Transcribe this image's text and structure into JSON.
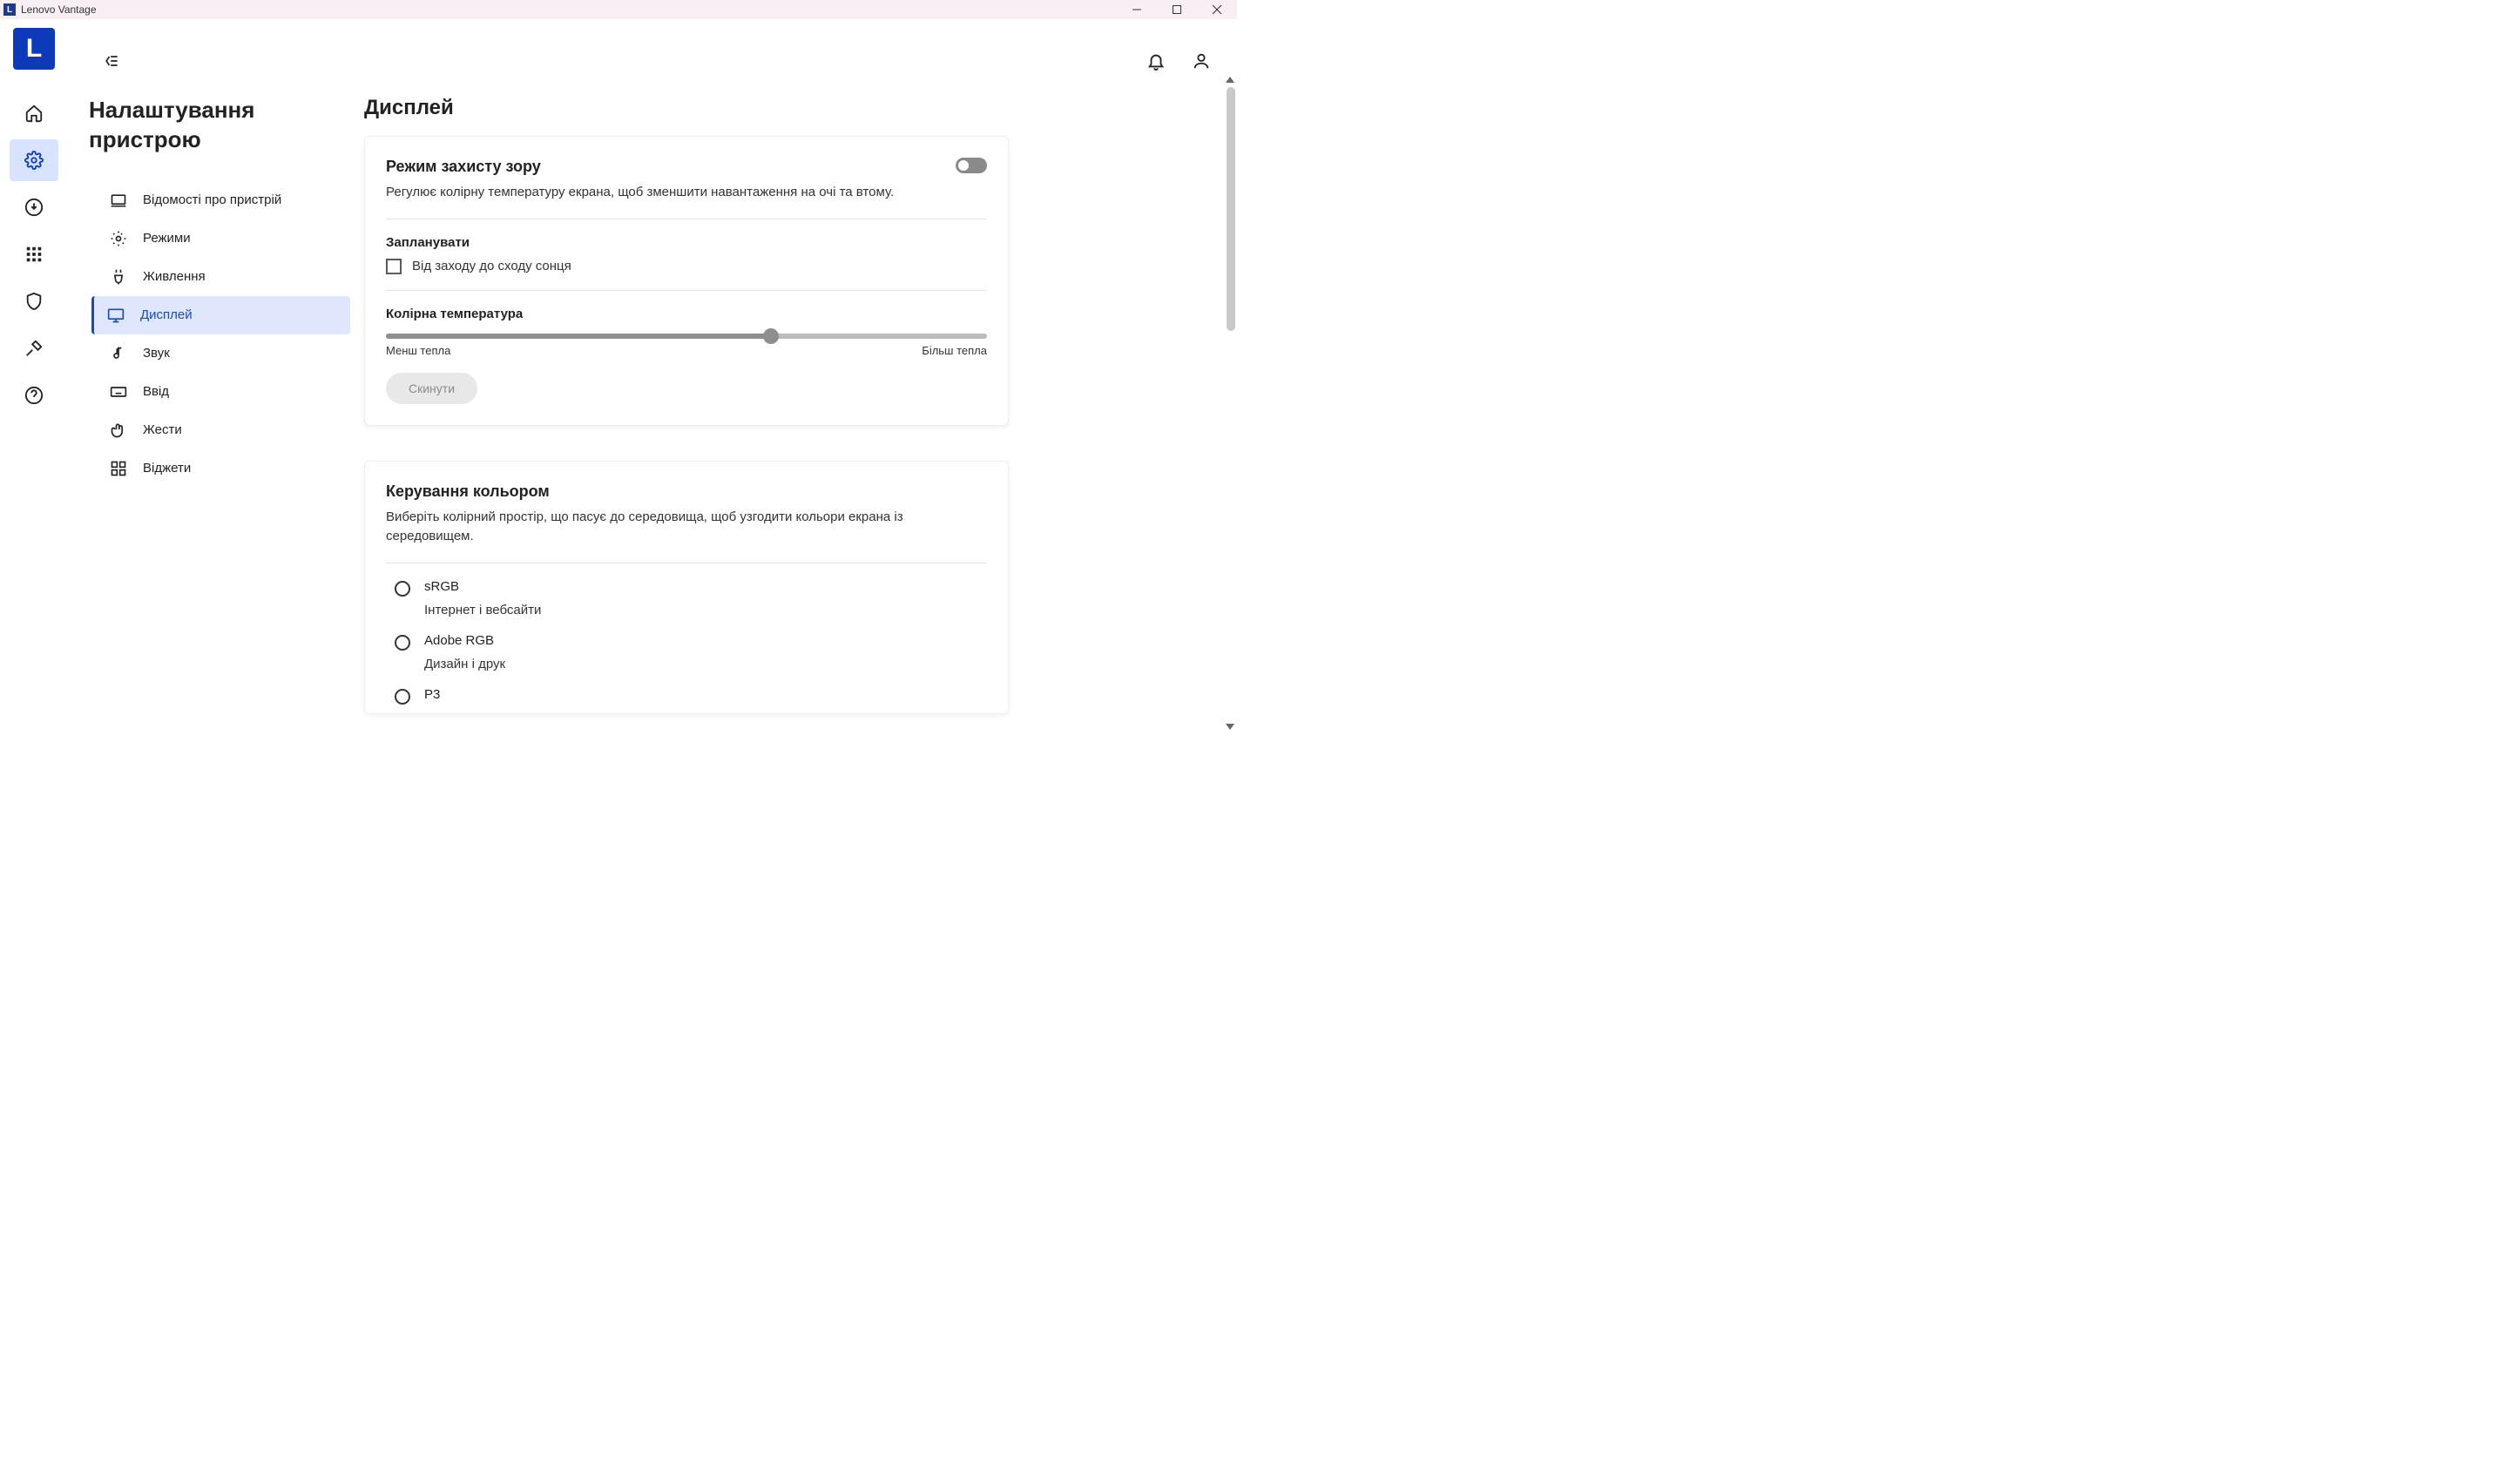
{
  "window": {
    "title": "Lenovo Vantage"
  },
  "sidepanel": {
    "title": "Налаштування пристрою",
    "items": [
      {
        "label": "Відомості про пристрій"
      },
      {
        "label": "Режими"
      },
      {
        "label": "Живлення"
      },
      {
        "label": "Дисплей"
      },
      {
        "label": "Звук"
      },
      {
        "label": "Ввід"
      },
      {
        "label": "Жести"
      },
      {
        "label": "Віджети"
      }
    ]
  },
  "page": {
    "title": "Дисплей"
  },
  "eyecare": {
    "title": "Режим захисту зору",
    "desc": "Регулює колірну температуру екрана, щоб зменшити навантаження на очі та втому.",
    "toggle": false,
    "schedule_label": "Запланувати",
    "sunset_label": "Від заходу до сходу сонця",
    "sunset_checked": false,
    "temp_label": "Колірна температура",
    "slider": {
      "min_label": "Менш тепла",
      "max_label": "Більш тепла",
      "value": 64
    },
    "reset_label": "Скинути"
  },
  "colormgmt": {
    "title": "Керування кольором",
    "desc": "Виберіть колірний простір, що пасує до середовища, щоб узгодити кольори екрана із середовищем.",
    "options": [
      {
        "title": "sRGB",
        "desc": "Інтернет і вебсайти"
      },
      {
        "title": "Adobe RGB",
        "desc": "Дизайн і друк"
      },
      {
        "title": "P3",
        "desc": ""
      }
    ]
  }
}
